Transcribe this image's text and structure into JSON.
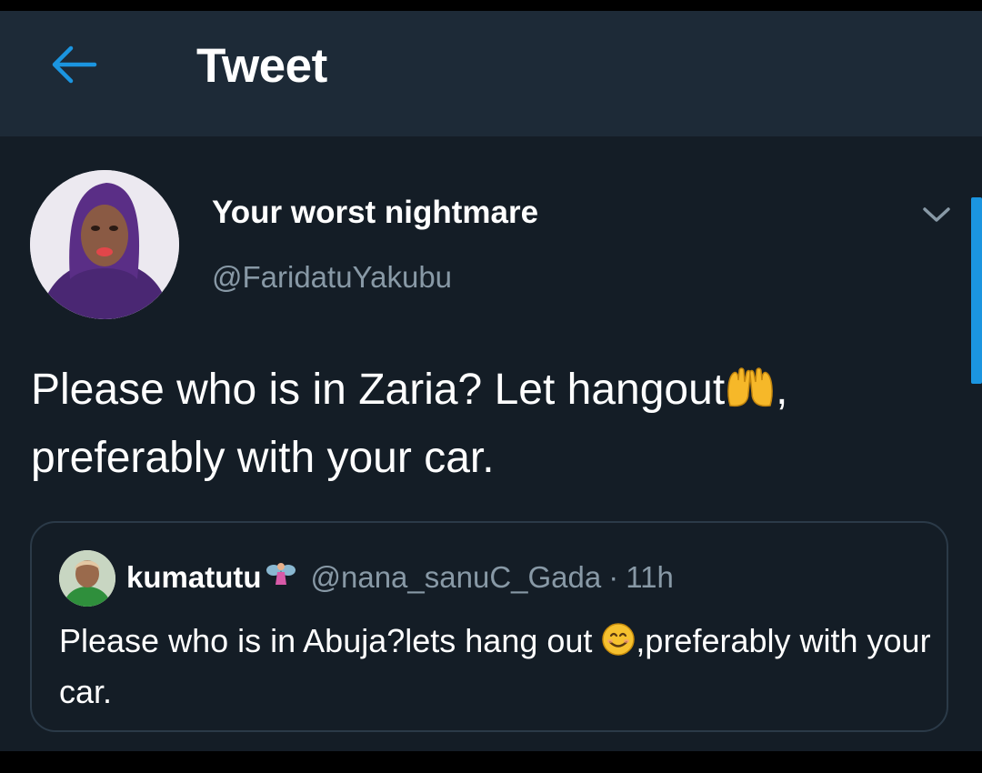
{
  "colors": {
    "background": "#141d26",
    "header": "#1d2a37",
    "accent": "#1b95e0",
    "secondary_text": "#8899a6",
    "primary_text": "#ffffff",
    "card_border": "#2b3a48"
  },
  "header": {
    "back_icon": "arrow-left-icon",
    "title": "Tweet"
  },
  "tweet": {
    "display_name": "Your worst nightmare",
    "handle": "@FaridatuYakubu",
    "text_part1": "Please who is in Zaria? Let hangout",
    "emoji": "raising-hands-emoji",
    "text_part2": ", preferably with your car.",
    "menu_icon": "chevron-down-icon"
  },
  "quoted_tweet": {
    "display_name": "kumatutu",
    "name_emoji": "fairy-emoji",
    "handle": "@nana_sanuC_Gada",
    "separator": "·",
    "time": "11h",
    "text_part1": "Please who is in Abuja?lets hang out ",
    "emoji": "smiling-face-emoji",
    "text_part2": ",preferably with your car."
  }
}
